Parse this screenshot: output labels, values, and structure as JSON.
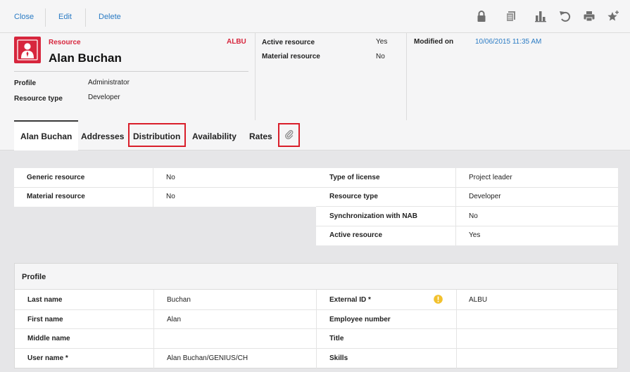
{
  "toolbar": {
    "close_label": "Close",
    "edit_label": "Edit",
    "delete_label": "Delete",
    "icons": [
      "lock-icon",
      "copy-icon",
      "bar-chart-icon",
      "undo-icon",
      "print-icon",
      "favorite-star-icon"
    ]
  },
  "header": {
    "entity_type": "Resource",
    "entity_code": "ALBU",
    "name": "Alan Buchan",
    "profile_label": "Profile",
    "profile_value": "Administrator",
    "resource_type_label": "Resource type",
    "resource_type_value": "Developer",
    "active_resource_label": "Active resource",
    "active_resource_value": "Yes",
    "material_resource_label": "Material resource",
    "material_resource_value": "No",
    "modified_on_label": "Modified on",
    "modified_on_value": "10/06/2015 11:35 AM",
    "accent_color": "#d7263d"
  },
  "tabs": [
    {
      "label": "Alan Buchan",
      "active": true
    },
    {
      "label": "Addresses",
      "active": false
    },
    {
      "label": "Distribution",
      "active": false,
      "highlighted": true
    },
    {
      "label": "Availability",
      "active": false
    },
    {
      "label": "Rates",
      "active": false
    },
    {
      "label": "",
      "icon": "attachment-icon",
      "highlighted": true
    }
  ],
  "general_left": [
    {
      "label": "Generic resource",
      "value": "No"
    },
    {
      "label": "Material resource",
      "value": "No"
    }
  ],
  "general_right": [
    {
      "label": "Type of license",
      "value": "Project leader"
    },
    {
      "label": "Resource type",
      "value": "Developer"
    },
    {
      "label": "Synchronization with NAB",
      "value": "No"
    },
    {
      "label": "Active resource",
      "value": "Yes"
    }
  ],
  "profile": {
    "title": "Profile",
    "left": [
      {
        "label": "Last name",
        "value": "Buchan"
      },
      {
        "label": "First name",
        "value": "Alan"
      },
      {
        "label": "Middle name",
        "value": ""
      },
      {
        "label": "User name *",
        "value": "Alan Buchan/GENIUS/CH"
      }
    ],
    "right": [
      {
        "label": "External ID *",
        "value": "ALBU"
      },
      {
        "label": "Employee number",
        "value": ""
      },
      {
        "label": "Title",
        "value": ""
      },
      {
        "label": "Skills",
        "value": ""
      }
    ]
  }
}
